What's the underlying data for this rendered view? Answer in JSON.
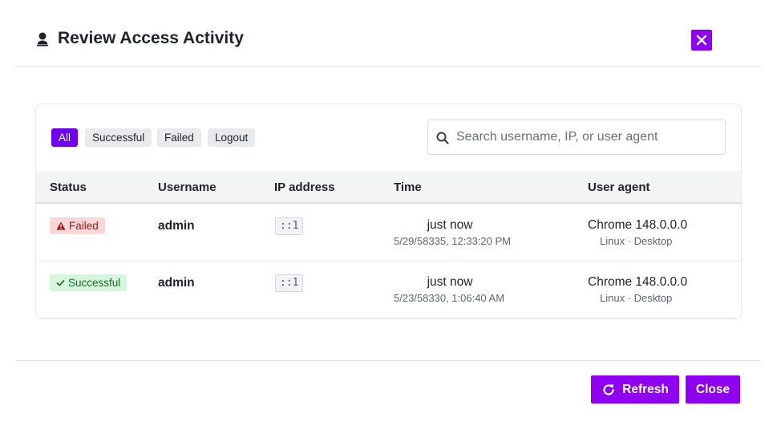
{
  "header": {
    "title": "Review Access Activity",
    "icon": "user-icon",
    "close_icon": "close-icon"
  },
  "filters": [
    {
      "label": "All",
      "active": true
    },
    {
      "label": "Successful",
      "active": false
    },
    {
      "label": "Failed",
      "active": false
    },
    {
      "label": "Logout",
      "active": false
    }
  ],
  "search": {
    "placeholder": "Search username, IP, or user agent",
    "value": ""
  },
  "table": {
    "columns": [
      "Status",
      "Username",
      "IP address",
      "Time",
      "User agent"
    ],
    "rows": [
      {
        "status": "Failed",
        "status_icon": "warning-icon",
        "username": "admin",
        "ip": "::1",
        "time_relative": "just now",
        "time_absolute": "5/29/58335, 12:33:20 PM",
        "user_agent": "Chrome 148.0.0.0",
        "device": "Linux · Desktop"
      },
      {
        "status": "Successful",
        "status_icon": "check-icon",
        "username": "admin",
        "ip": "::1",
        "time_relative": "just now",
        "time_absolute": "5/23/58330, 1:06:40 AM",
        "user_agent": "Chrome 148.0.0.0",
        "device": "Linux · Desktop"
      }
    ]
  },
  "footer": {
    "refresh_label": "Refresh",
    "refresh_icon": "refresh-icon",
    "close_label": "Close"
  },
  "colors": {
    "accent": "#8f00f0",
    "active_filter": "#6f00ee",
    "failed_bg": "#fcd7d9",
    "failed_text": "#9b1b1b",
    "success_bg": "#d6f5dc",
    "success_text": "#1a6b2c"
  }
}
